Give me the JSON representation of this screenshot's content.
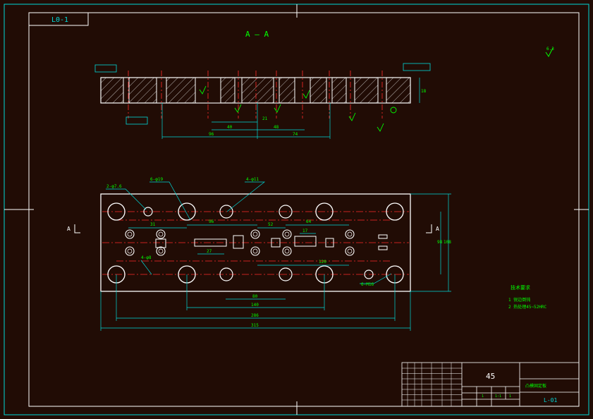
{
  "sheet": {
    "drawing_code_corner": "L0-1",
    "section_label": "A — A",
    "view_marker_left": "A",
    "view_marker_right": "A"
  },
  "dimensions": {
    "overall_length": "315",
    "length_2": "286",
    "length_3": "140",
    "length_4": "80",
    "height_1": "98",
    "height_2": "108",
    "d96": "96",
    "d74": "74",
    "d65": "65",
    "d52": "52",
    "d64": "64",
    "d120": "120",
    "d27": "27",
    "d17": "17",
    "d31": "31",
    "d21": "21",
    "d48": "48",
    "d40": "40",
    "d65b": "65",
    "thickness": "18"
  },
  "callouts": {
    "hole_a": "2-φ7.6",
    "hole_b": "6-φ19",
    "hole_c": "4-φ11",
    "hole_d": "6-M16",
    "hole_e": "4-φ8"
  },
  "notes": {
    "heading": "技术要求",
    "line1": "1 锐边倒钝",
    "line2": "2 热处理45~52HRC"
  },
  "surface_finish": "6.3",
  "title_block": {
    "material": "45",
    "part_name": "凸模固定板",
    "drawing_number": "L-01",
    "scale": "1:1",
    "sheet_count": "1",
    "sheet_index": "1"
  }
}
